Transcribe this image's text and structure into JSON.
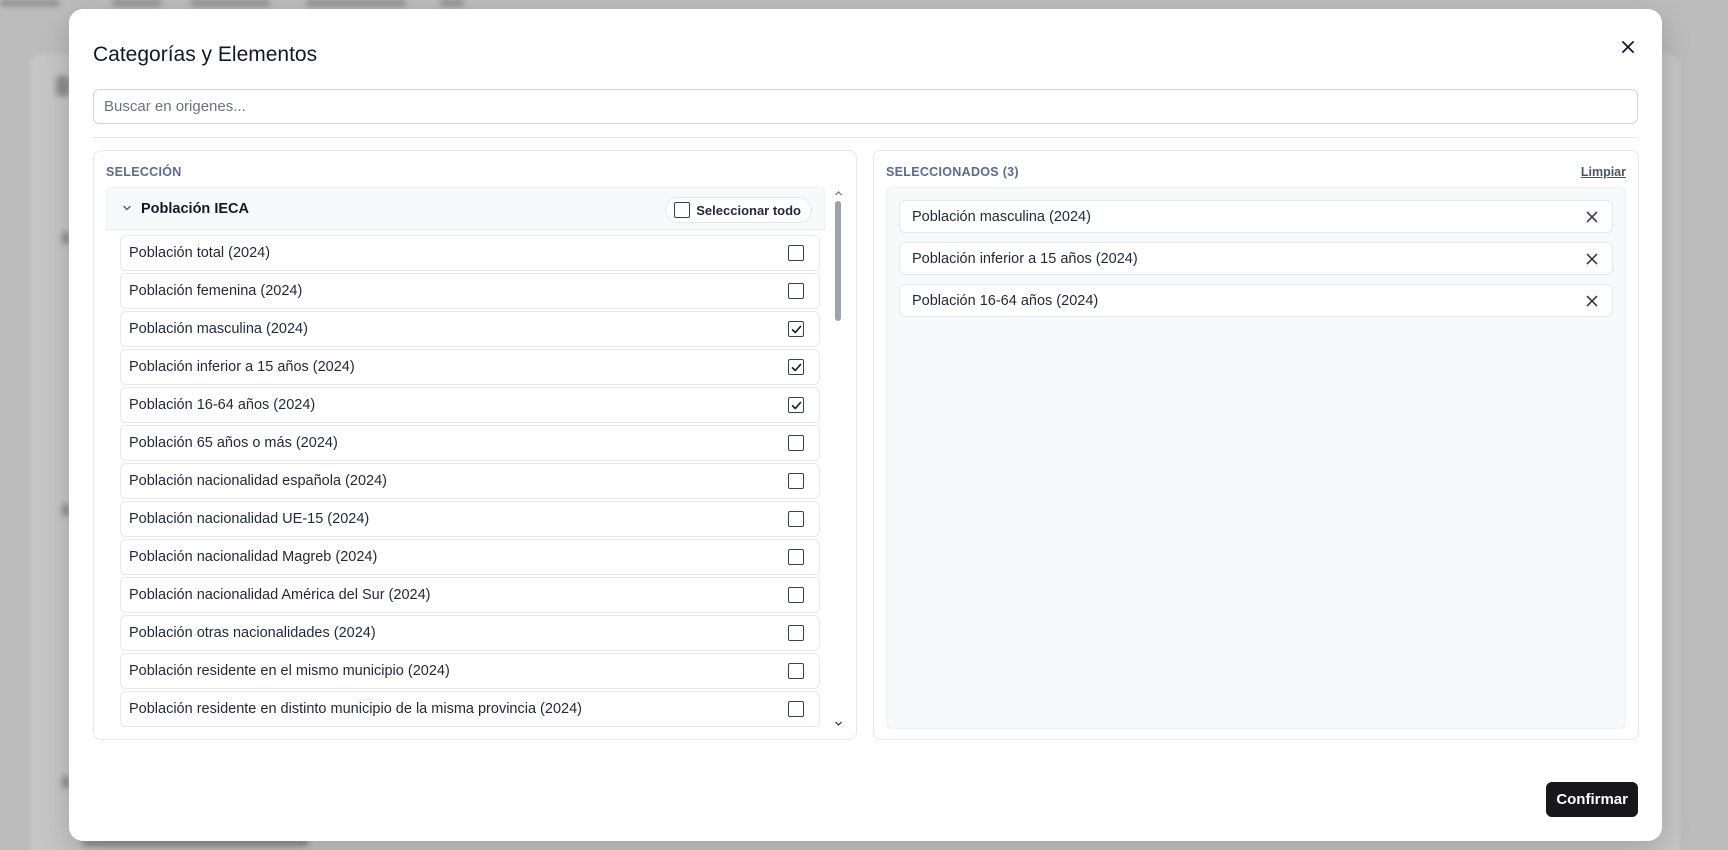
{
  "modal": {
    "title": "Categorías y Elementos",
    "search_placeholder": "Buscar en origenes...",
    "confirm_label": "Confirmar"
  },
  "selection": {
    "label": "SELECCIÓN",
    "group": {
      "title": "Población IECA",
      "expanded": true,
      "select_all_label": "Seleccionar todo",
      "select_all_checked": false
    },
    "items": [
      {
        "label": "Población total (2024)",
        "checked": false
      },
      {
        "label": "Población femenina (2024)",
        "checked": false
      },
      {
        "label": "Población masculina (2024)",
        "checked": true
      },
      {
        "label": "Población inferior a 15 años (2024)",
        "checked": true
      },
      {
        "label": "Población 16-64 años (2024)",
        "checked": true
      },
      {
        "label": "Población 65 años o más (2024)",
        "checked": false
      },
      {
        "label": "Población nacionalidad española (2024)",
        "checked": false
      },
      {
        "label": "Población nacionalidad UE-15 (2024)",
        "checked": false
      },
      {
        "label": "Población nacionalidad Magreb (2024)",
        "checked": false
      },
      {
        "label": "Población nacionalidad América del Sur (2024)",
        "checked": false
      },
      {
        "label": "Población otras nacionalidades (2024)",
        "checked": false
      },
      {
        "label": "Población residente en el mismo municipio (2024)",
        "checked": false
      },
      {
        "label": "Población residente en distinto municipio de la misma provincia (2024)",
        "checked": false
      }
    ]
  },
  "selected": {
    "label": "SELECCIONADOS (3)",
    "clear_label": "Limpiar",
    "items": [
      {
        "label": "Población masculina (2024)"
      },
      {
        "label": "Población inferior a 15 años (2024)"
      },
      {
        "label": "Población 16-64 años (2024)"
      }
    ]
  },
  "colors": {
    "confirm_bg": "#18181b",
    "panel_label": "#5b6b8c"
  }
}
